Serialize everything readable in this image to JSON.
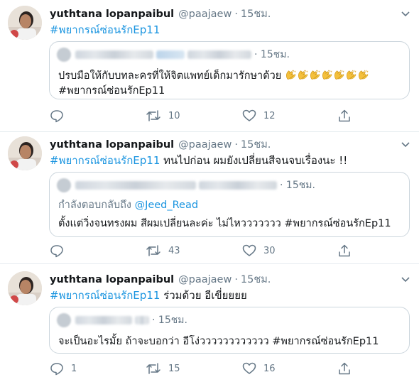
{
  "tweets": [
    {
      "name": "yuthtana lopanpaibul",
      "handle": "@paajaew",
      "time": "15ชม.",
      "hashtag": "#พยากรณ์ซ่อนรักEp11",
      "text": "",
      "quote": {
        "time": "15ชม.",
        "reply_prefix": "",
        "reply_mention": "",
        "line1": "ปรบมือให้กับบทละครที่ให้จิตแพทย์เด็กมารักษาด้วย",
        "emoji": "clapping-hands-icon",
        "emoji_count": 7,
        "line2": "#พยากรณ์ซ่อนรักEp11"
      },
      "actions": {
        "replies": "",
        "retweets": "10",
        "likes": "12"
      }
    },
    {
      "name": "yuthtana lopanpaibul",
      "handle": "@paajaew",
      "time": "15ชม.",
      "hashtag": "#พยากรณ์ซ่อนรักEp11",
      "text": " ทนไปก่อน ผมยังเปลี่ยนสีจนจบเรื่องนะ !!",
      "quote": {
        "time": "15ชม.",
        "reply_prefix": "กำลังตอบกลับถึง ",
        "reply_mention": "@Jeed_Read",
        "line1": "ตั้งแต่วิ่งจนทรงผม สีผมเปลี่ยนละค่ะ ไม่ไหววววววว #พยากรณ์ซ่อนรักEp11",
        "line2": ""
      },
      "actions": {
        "replies": "",
        "retweets": "43",
        "likes": "30"
      }
    },
    {
      "name": "yuthtana lopanpaibul",
      "handle": "@paajaew",
      "time": "15ชม.",
      "hashtag": "#พยากรณ์ซ่อนรักEp11",
      "text": " ร่วมด้วย อีเขี่ยยยย",
      "quote": {
        "time": "15ชม.",
        "reply_prefix": "",
        "reply_mention": "",
        "line1": "จะเป็นอะไรมั้ย ถ้าจะบอกว่า อีโง่วววววววววววว #พยากรณ์ซ่อนรักEp11",
        "line2": ""
      },
      "actions": {
        "replies": "1",
        "retweets": "15",
        "likes": "16"
      }
    }
  ],
  "colors": {
    "link": "#1b95e0",
    "muted": "#657786",
    "border": "#ccd6dd",
    "divider": "#e6ecf0"
  }
}
